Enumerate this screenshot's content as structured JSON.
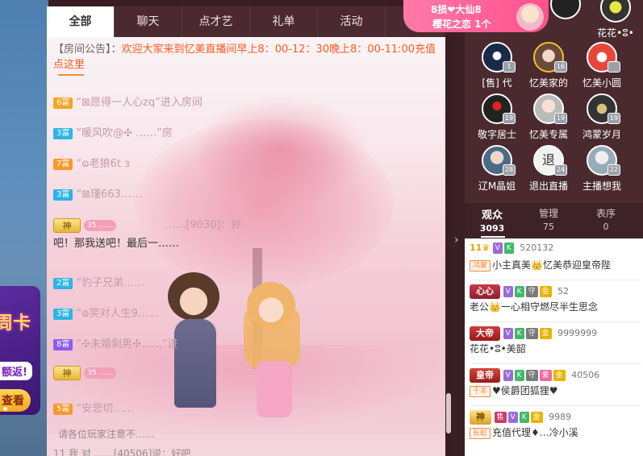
{
  "tabs": [
    "全部",
    "聊天",
    "点才艺",
    "礼单",
    "活动"
  ],
  "notice": {
    "label": "【房间公告】：",
    "text": "欢迎大家来到忆美直播间早上8：00-12：30晚上8：00-11:00充值点这里"
  },
  "messages": [
    {
      "level": "6富",
      "level_color": "y",
      "text": "“⊠愿得一人心zq”进入房间"
    },
    {
      "level": "3富",
      "level_color": "b",
      "text": "“暖风吹@✣ ……”房"
    },
    {
      "level": "7富",
      "level_color": "o",
      "text": "“ɷ老狼6t ɜ"
    },
    {
      "level": "3富",
      "level_color": "b",
      "text": "“⊠瑾663……"
    },
    {
      "level": "神",
      "level_color": "god",
      "pink": "35 ……",
      "text": "……[9030]：好"
    },
    {
      "level": "",
      "level_color": "",
      "text": "吧！那我送吧！最后一……"
    },
    {
      "level": "2富",
      "level_color": "b",
      "text": "“豹子兄弟……"
    },
    {
      "level": "3富",
      "level_color": "b",
      "text": "“ɷ笑对人生9……"
    },
    {
      "level": "8富",
      "level_color": "p",
      "text": "“✣未婚剩男✣……”进"
    },
    {
      "level": "神",
      "level_color": "god",
      "pink": "35 ……",
      "text": ""
    },
    {
      "level": "5富",
      "level_color": "o",
      "text": "“安悲切……"
    }
  ],
  "footer": {
    "tip": "请各位玩家注意不……",
    "last_line": "11 我 对 ……[40506]说：好吧"
  },
  "love": {
    "top": "8损❤大仙8",
    "bottom": "樱花之恋 1个"
  },
  "top_avatars": [
    {
      "label": "",
      "level": ""
    },
    {
      "label": "花花•ⵓ•",
      "level": ""
    }
  ],
  "avatars": [
    {
      "label": "[售] 代",
      "level": "1"
    },
    {
      "label": "忆美家的",
      "level": "16"
    },
    {
      "label": "忆美小圆",
      "level": ""
    },
    {
      "label": "敬字居士",
      "level": "19"
    },
    {
      "label": "忆美专属",
      "level": "19"
    },
    {
      "label": "鸿蒙岁月",
      "level": "19"
    },
    {
      "label": "辽M晶姐",
      "level": "28"
    },
    {
      "label": "退出直播",
      "level": "24"
    },
    {
      "label": "主播想我",
      "level": "22"
    }
  ],
  "audience_tabs": [
    {
      "label": "观众",
      "count": "3093"
    },
    {
      "label": "管理",
      "count": "75"
    },
    {
      "label": "表序",
      "count": "0"
    }
  ],
  "audience": [
    {
      "title": "11",
      "title_style": "level",
      "chips": [
        "V",
        "K"
      ],
      "score": "520132",
      "tag": "鸿蒙",
      "name": "小主真美👑忆美恭迎皇帝陛"
    },
    {
      "title": "心心",
      "title_style": "heart",
      "chips": [
        "V",
        "K",
        "守",
        "金"
      ],
      "score": "52",
      "tag": "",
      "name": "老公👑一心相守燃尽半生思念"
    },
    {
      "title": "大帝",
      "title_style": "emp",
      "chips": [
        "V",
        "K",
        "守",
        "金"
      ],
      "score": "9999999",
      "tag": "",
      "name": "花花•ⵓ•美韶"
    },
    {
      "title": "皇帝",
      "title_style": "huang",
      "chips": [
        "V",
        "K",
        "守",
        "爱",
        "金"
      ],
      "score": "40506",
      "tag": "千羊",
      "name": "♥侯爵团狐狸♥"
    },
    {
      "title": "神",
      "title_style": "shen",
      "chips": [
        "售",
        "V",
        "K",
        "金"
      ],
      "score": "9989",
      "tag": "长虹",
      "name": "充值代理♦…冷小溪"
    }
  ],
  "colors": {
    "panel_dark": "#4a2a2f",
    "notice": "#ff5a1f",
    "love_pink": "#ff4f8b"
  }
}
